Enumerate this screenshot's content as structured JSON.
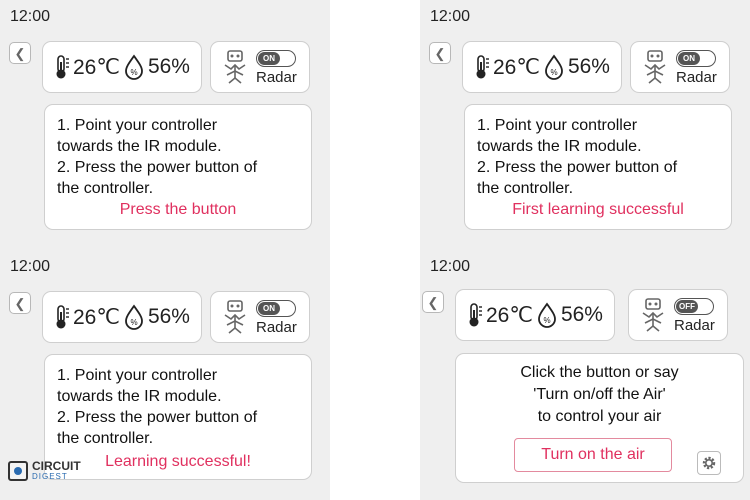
{
  "screens": [
    {
      "time": "12:00",
      "temperature": "26℃",
      "humidity": "56%",
      "toggle": "ON",
      "radar_label": "Radar",
      "instructions": [
        "1. Point your controller",
        "towards the IR module.",
        "2. Press the power button of",
        "the controller."
      ],
      "status": "Press the button"
    },
    {
      "time": "12:00",
      "temperature": "26℃",
      "humidity": "56%",
      "toggle": "ON",
      "radar_label": "Radar",
      "instructions": [
        "1. Point your controller",
        "towards the IR module.",
        "2. Press the power button of",
        "the controller."
      ],
      "status": "First learning successful"
    },
    {
      "time": "12:00",
      "temperature": "26℃",
      "humidity": "56%",
      "toggle": "ON",
      "radar_label": "Radar",
      "instructions": [
        "1. Point your controller",
        "towards the IR module.",
        "2. Press the power button of",
        "the controller."
      ],
      "status": "Learning successful!"
    },
    {
      "time": "12:00",
      "temperature": "26℃",
      "humidity": "56%",
      "toggle": "OFF",
      "radar_label": "Radar",
      "control_text": [
        "Click the button or say",
        "'Turn on/off the Air'",
        "to control your air"
      ],
      "button": "Turn on the air"
    }
  ],
  "logo": {
    "line1": "CIRCUIT",
    "line2": "DIGEST"
  },
  "colors": {
    "status": "#e0305f",
    "panel_bg": "#efefef",
    "card_bg": "#ffffff",
    "accent": "#2a6bb0"
  }
}
